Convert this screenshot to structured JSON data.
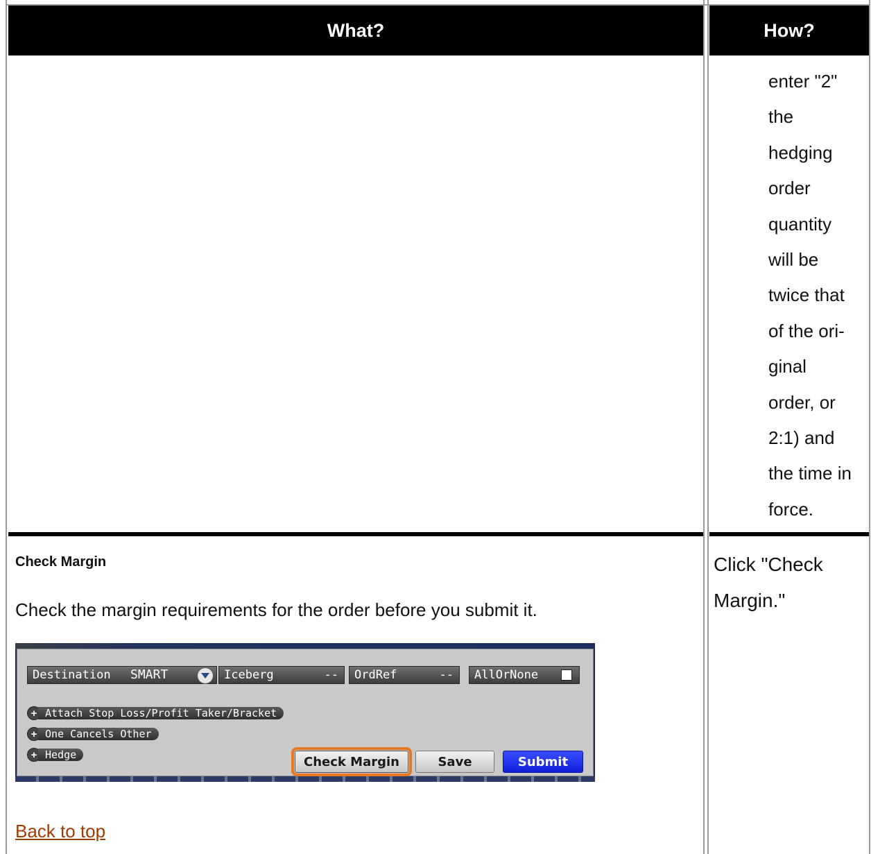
{
  "table": {
    "headers": {
      "what": "What?",
      "how": "How?"
    },
    "row1": {
      "how_lines": [
        "enter \"2\"",
        "the",
        "hedging",
        "order",
        "quantity",
        "will be",
        "twice that",
        "of the ori-",
        "ginal",
        "order, or",
        "2:1) and",
        "the time in",
        "force."
      ]
    },
    "row2": {
      "title": "Check Margin",
      "description": "Check the margin requirements for the order before you submit it.",
      "how": "Click \"Check Margin.\"",
      "back_link": "Back to top"
    }
  },
  "order_panel": {
    "destination_label": "Destination",
    "destination_value": "SMART",
    "iceberg_label": "Iceberg",
    "iceberg_value": "--",
    "ordref_label": "OrdRef",
    "ordref_value": "--",
    "allornone_label": "AllOrNone",
    "expanders": [
      "Attach Stop Loss/Profit Taker/Bracket",
      "One Cancels Other",
      "Hedge"
    ],
    "buttons": {
      "check_margin": "Check Margin",
      "save": "Save",
      "submit": "Submit"
    },
    "colors": {
      "highlight": "#e87722",
      "submit": "#1a2ee8"
    }
  }
}
